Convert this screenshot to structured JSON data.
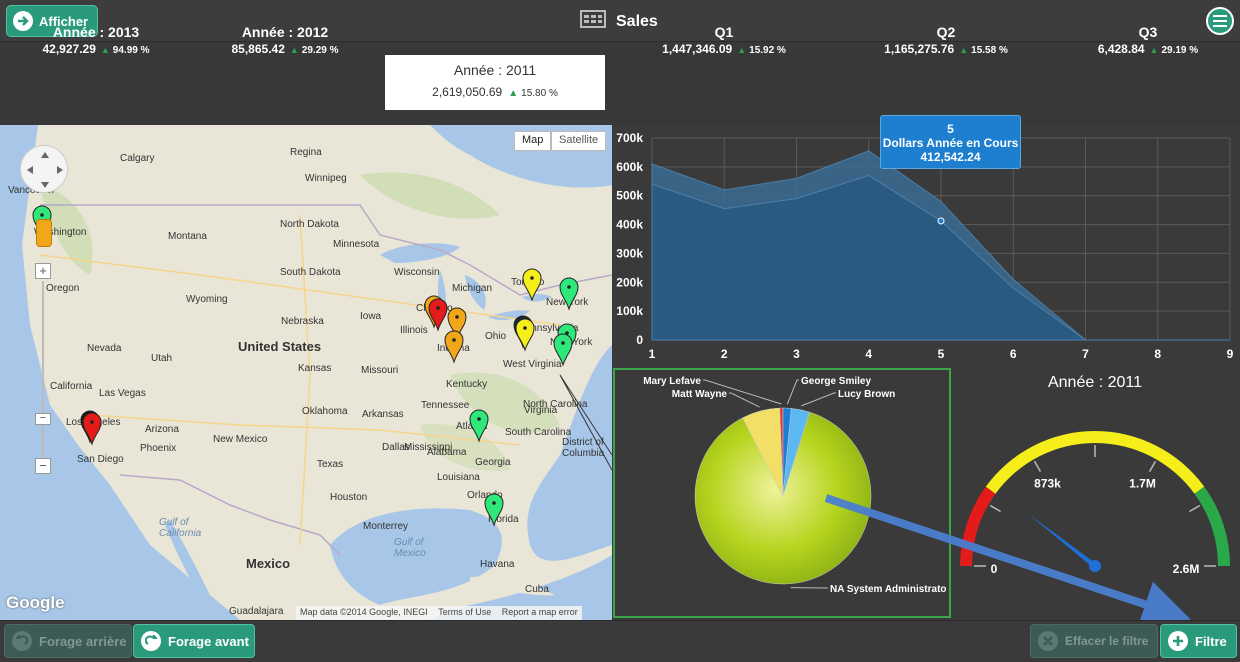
{
  "header": {
    "afficher_label": "Afficher",
    "title": "Sales",
    "menu_icon": "hamburger-icon"
  },
  "kpis": [
    {
      "label": "Année : 2013",
      "value": "42,927.29",
      "pct": "94.99 %"
    },
    {
      "label": "Année : 2012",
      "value": "85,865.42",
      "pct": "29.29 %"
    },
    {
      "label": "Année : 2011",
      "value": "2,619,050.69",
      "pct": "15.80 %"
    },
    {
      "label": "Q1",
      "value": "1,447,346.09",
      "pct": "15.92 %"
    },
    {
      "label": "Q2",
      "value": "1,165,275.76",
      "pct": "15.58 %"
    },
    {
      "label": "Q3",
      "value": "6,428.84",
      "pct": "29.19 %"
    }
  ],
  "map": {
    "tab_map": "Map",
    "tab_satellite": "Satellite",
    "attribution": "Map data ©2014 Google, INEGI",
    "terms": "Terms of Use",
    "report": "Report a map error",
    "logo": "Google",
    "zoom_in": "+",
    "zoom_out": "−",
    "zoom_out2": "−",
    "places": [
      "Vancouver",
      "Calgary",
      "Regina",
      "Winnipeg",
      "Washington",
      "Montana",
      "North Dakota",
      "Minnesota",
      "Oregon",
      "South Dakota",
      "Wisconsin",
      "Wyoming",
      "Michigan",
      "Toronto",
      "New York",
      "Nebraska",
      "Iowa",
      "Chicago",
      "Illinois",
      "Indiana",
      "Ohio",
      "Pennsylvania",
      "New York",
      "Nevada",
      "United States",
      "Utah",
      "Kansas",
      "Missouri",
      "West Virginia",
      "California",
      "Las Vegas",
      "Kentucky",
      "Virginia",
      "Los Angeles",
      "Arizona",
      "Oklahoma",
      "Arkansas",
      "Tennessee",
      "North Carolina",
      "New Mexico",
      "Atlanta",
      "South Carolina",
      "Phoenix",
      "District of Columbia",
      "San Diego",
      "Dallas",
      "Mississippi",
      "Alabama",
      "Georgia",
      "Texas",
      "Louisiana",
      "Houston",
      "Orlando",
      "Florida",
      "Gulf of California",
      "Monterrey",
      "Mexico",
      "Gulf of Mexico",
      "Havana",
      "Cuba",
      "Guadalajara"
    ]
  },
  "area_chart": {
    "tooltip_x": "5",
    "tooltip_series": "Dollars Année en Cours",
    "tooltip_value": "412,542.24"
  },
  "chart_data": [
    {
      "type": "area",
      "x": [
        1,
        2,
        3,
        4,
        5,
        6,
        7,
        8,
        9
      ],
      "series": [
        {
          "values": [
            610000,
            520000,
            560000,
            655000,
            480000,
            210000,
            0,
            0,
            0
          ]
        },
        {
          "name": "Dollars Année en Cours",
          "values": [
            540000,
            455000,
            490000,
            570000,
            412542.24,
            180000,
            0,
            0,
            0
          ]
        }
      ],
      "ylim": [
        0,
        700000
      ],
      "yticks": [
        "0",
        "100k",
        "200k",
        "300k",
        "400k",
        "500k",
        "600k",
        "700k"
      ],
      "xticks": [
        "1",
        "2",
        "3",
        "4",
        "5",
        "6",
        "7",
        "8",
        "9"
      ],
      "grid": true
    },
    {
      "type": "pie",
      "slices": [
        {
          "label": "NA System Administrato",
          "value": 87.5,
          "color": "#a7cc1a"
        },
        {
          "label": "Matt Wayne",
          "value": 7.0,
          "color": "#f2e066"
        },
        {
          "label": "Mary Lefave",
          "value": 0.6,
          "color": "#e8342c"
        },
        {
          "label": "George Smiley",
          "value": 1.5,
          "color": "#1c7fd6"
        },
        {
          "label": "Lucy Brown",
          "value": 3.4,
          "color": "#5cb8f0"
        }
      ]
    },
    {
      "type": "gauge",
      "title": "Année : 2011",
      "min": 0,
      "max": 2600000,
      "value": 550000,
      "tick_labels": [
        "0",
        "873k",
        "1.7M",
        "2.6M"
      ]
    }
  ],
  "footer": {
    "back_label": "Forage arrière",
    "forward_label": "Forage avant",
    "clear_label": "Effacer le filtre",
    "filter_label": "Filtre"
  },
  "colors": {
    "accent": "#2a9a7c",
    "tooltip": "#1e7fd0",
    "pie_border": "#3aa54a"
  }
}
